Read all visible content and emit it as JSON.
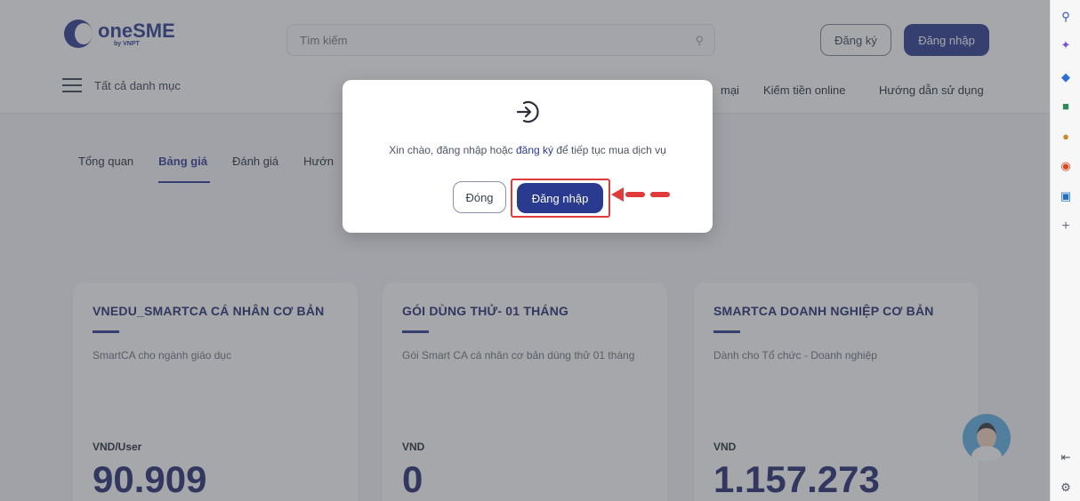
{
  "header": {
    "brand_name": "oneSME",
    "brand_sub": "by VNPT",
    "search_placeholder": "Tìm kiếm",
    "register_label": "Đăng ký",
    "login_label": "Đăng nhập"
  },
  "category_bar": {
    "all_categories_label": "Tất cả danh mục",
    "menu_items": [
      "mại",
      "Kiếm tiền online",
      "Hướng dẫn sử dụng"
    ]
  },
  "tabs": [
    "Tổng quan",
    "Bảng giá",
    "Đánh giá",
    "Hướn"
  ],
  "cards": [
    {
      "title": "VNEDU_SMARTCA CÁ NHÂN CƠ BẢN",
      "desc": "SmartCA cho ngành giáo dục",
      "unit": "VND/User",
      "price": "90.909"
    },
    {
      "title": "GÓI DÙNG THỬ- 01 THÁNG",
      "desc": "Gói Smart CA cá nhân cơ bản dùng thử 01 tháng",
      "unit": "VND",
      "price": "0"
    },
    {
      "title": "SMARTCA DOANH NGHIỆP CƠ BẢN",
      "desc": "Dành cho Tổ chức - Doanh nghiệp",
      "unit": "VND",
      "price": "1.157.273"
    }
  ],
  "modal": {
    "message_prefix": "Xin chào, đăng nhập hoặc ",
    "message_link": "đăng ký",
    "message_suffix": " để tiếp tục mua dịch vụ",
    "close_label": "Đóng",
    "login_label": "Đăng nhập"
  },
  "colors": {
    "brand": "#2a3a8f",
    "highlight": "#e03a3a"
  }
}
